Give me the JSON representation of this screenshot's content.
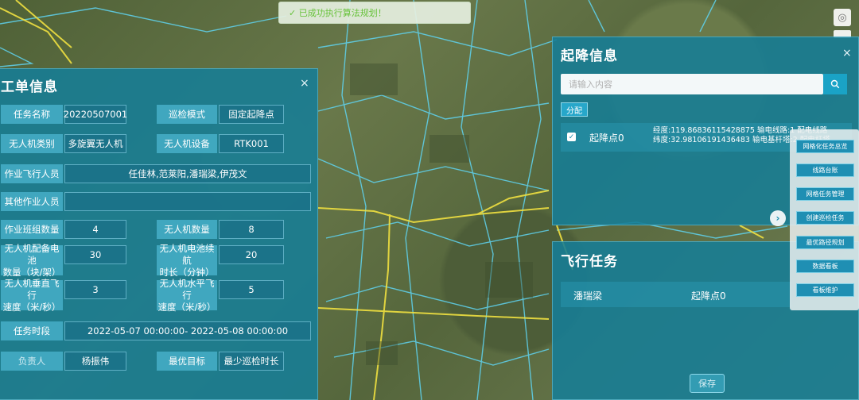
{
  "toast": {
    "message": "✓ 已成功执行算法规划！"
  },
  "work_order": {
    "title": "工单信息",
    "close": "×",
    "fields": {
      "task_name": {
        "label": "任务名称",
        "value": "20220507001"
      },
      "patrol_mode": {
        "label": "巡检模式",
        "value": "固定起降点"
      },
      "uav_type": {
        "label": "无人机类别",
        "value": "多旋翼无人机"
      },
      "uav_device": {
        "label": "无人机设备",
        "value": "RTK001"
      },
      "flight_crew": {
        "label": "作业飞行人员",
        "value": "任佳林,范莱阳,潘瑞梁,伊茂文"
      },
      "other_crew": {
        "label": "其他作业人员",
        "value": ""
      },
      "team_count": {
        "label": "作业班组数量",
        "value": "4"
      },
      "uav_count": {
        "label": "无人机数量",
        "value": "8"
      },
      "battery_count": {
        "label_line1": "无人机配备电池",
        "label_line2": "数量（块/架）",
        "value": "30"
      },
      "battery_life": {
        "label_line1": "无人机电池续航",
        "label_line2": "时长（分钟）",
        "value": "20"
      },
      "vertical_speed": {
        "label_line1": "无人机垂直飞行",
        "label_line2": "速度（米/秒）",
        "value": "3"
      },
      "horizontal_speed": {
        "label_line1": "无人机水平飞行",
        "label_line2": "速度（米/秒）",
        "value": "5"
      },
      "task_period": {
        "label": "任务时段",
        "value": "2022-05-07 00:00:00- 2022-05-08 00:00:00"
      },
      "owner": {
        "label": "负责人",
        "value": "杨振伟"
      },
      "objective": {
        "label": "最优目标",
        "value": "最少巡检时长"
      }
    }
  },
  "takeoff": {
    "title": "起降信息",
    "close": "×",
    "search_placeholder": "请输入内容",
    "assign_label": "分配",
    "point": {
      "name": "起降点0",
      "line1": "经度:119.86836115428875  输电线路:1    配电线路",
      "line2": "纬度:32.98106191436483  输电基杆塔:2  配电杆塔"
    }
  },
  "flight_task": {
    "title": "飞行任务",
    "row": {
      "person": "潘瑞梁",
      "point": "起降点0"
    },
    "save_label": "保存"
  },
  "side_menu": [
    "网格化任务总览",
    "线路台账",
    "网格任务管理",
    "创建巡检任务",
    "最优路径规划",
    "数据看板",
    "看板维护"
  ],
  "colors": {
    "panel": "#167d96",
    "accent": "#1aa3c6",
    "power_line": "#f0e040",
    "parcel_line": "#5fd3f0",
    "success": "#67c23a"
  }
}
